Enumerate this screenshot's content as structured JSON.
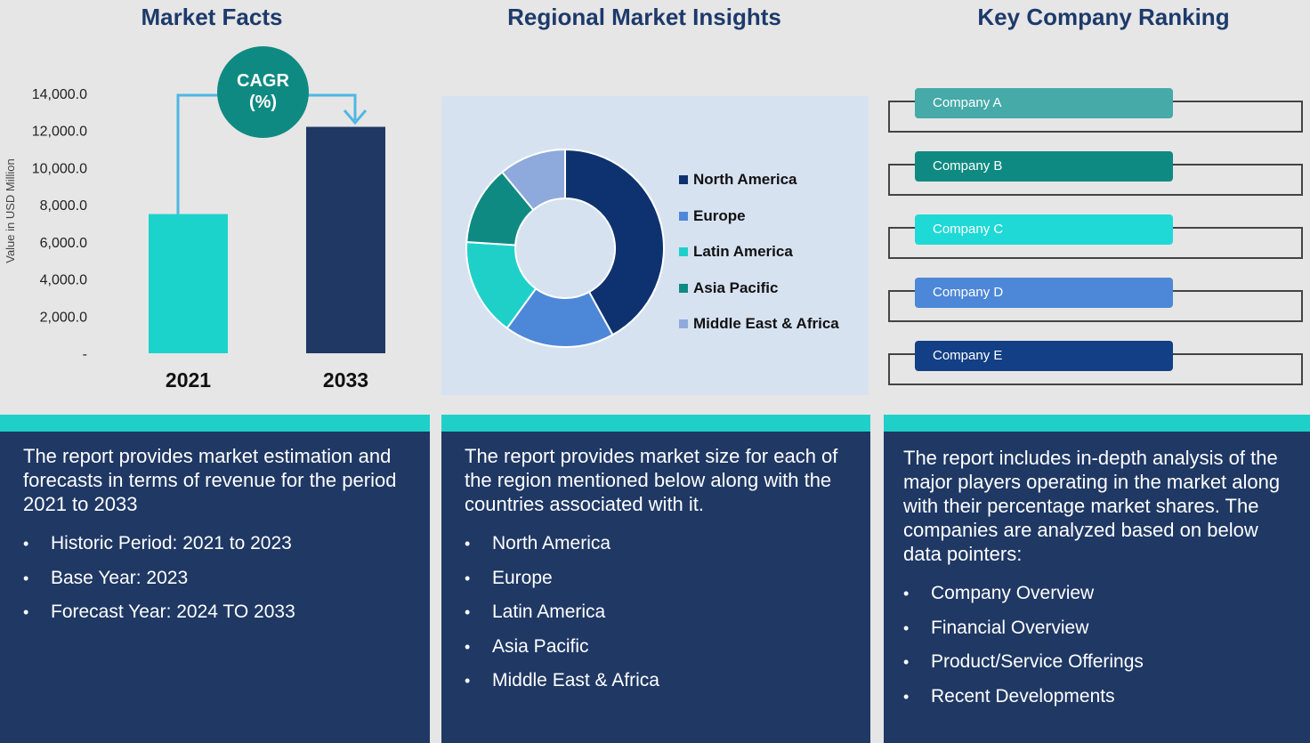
{
  "headings": {
    "market_facts": "Market Facts",
    "regional": "Regional Market Insights",
    "ranking": "Key Company Ranking"
  },
  "cagr": {
    "line1": "CAGR",
    "line2": "(%)"
  },
  "colors": {
    "navy": "#1f3864",
    "teal": "#0f8a82",
    "cyan": "#1fd0c9",
    "heading": "#1d3a6b"
  },
  "chart_data": [
    {
      "type": "bar",
      "categories": [
        "2021",
        "2033"
      ],
      "values": [
        7500,
        12200
      ],
      "bar_colors": [
        "#1bd3cb",
        "#1f3864"
      ],
      "ylabel": "Value in USD Million",
      "yticks": [
        "14,000.0",
        "12,000.0",
        "10,000.0",
        "8,000.0",
        "6,000.0",
        "4,000.0",
        "2,000.0",
        "-"
      ],
      "ylim": [
        0,
        14000
      ],
      "grid": false
    },
    {
      "type": "pie",
      "donut": true,
      "categories": [
        "North America",
        "Europe",
        "Latin America",
        "Asia Pacific",
        "Middle East & Africa"
      ],
      "values": [
        42,
        18,
        16,
        13,
        11
      ],
      "slice_colors": [
        "#0e3270",
        "#4d87d8",
        "#1fd0c9",
        "#0f8a82",
        "#8ea9dc"
      ],
      "legend_position": "right"
    }
  ],
  "ranking": [
    {
      "label": "Company A",
      "color": "#45aaa8"
    },
    {
      "label": "Company B",
      "color": "#0f8a82"
    },
    {
      "label": "Company C",
      "color": "#1fd9d6"
    },
    {
      "label": "Company D",
      "color": "#4d87d8"
    },
    {
      "label": "Company E",
      "color": "#123f85"
    }
  ],
  "panels": {
    "market_facts": {
      "intro": "The report provides market estimation and forecasts in terms of revenue for the period 2021 to 2033",
      "items": [
        "Historic Period: 2021 to 2023",
        "Base Year: 2023",
        "Forecast Year: 2024 TO 2033"
      ]
    },
    "regional": {
      "intro": "The report provides market size for each of the region mentioned below along with the countries associated with it.",
      "items": [
        "North America",
        "Europe",
        "Latin America",
        "Asia Pacific",
        "Middle East & Africa"
      ]
    },
    "ranking": {
      "intro": "The report includes in-depth analysis of the major players operating in the market along with their percentage market shares. The companies are analyzed based on below data pointers:",
      "items": [
        "Company Overview",
        "Financial Overview",
        "Product/Service Offerings",
        "Recent Developments"
      ]
    }
  }
}
